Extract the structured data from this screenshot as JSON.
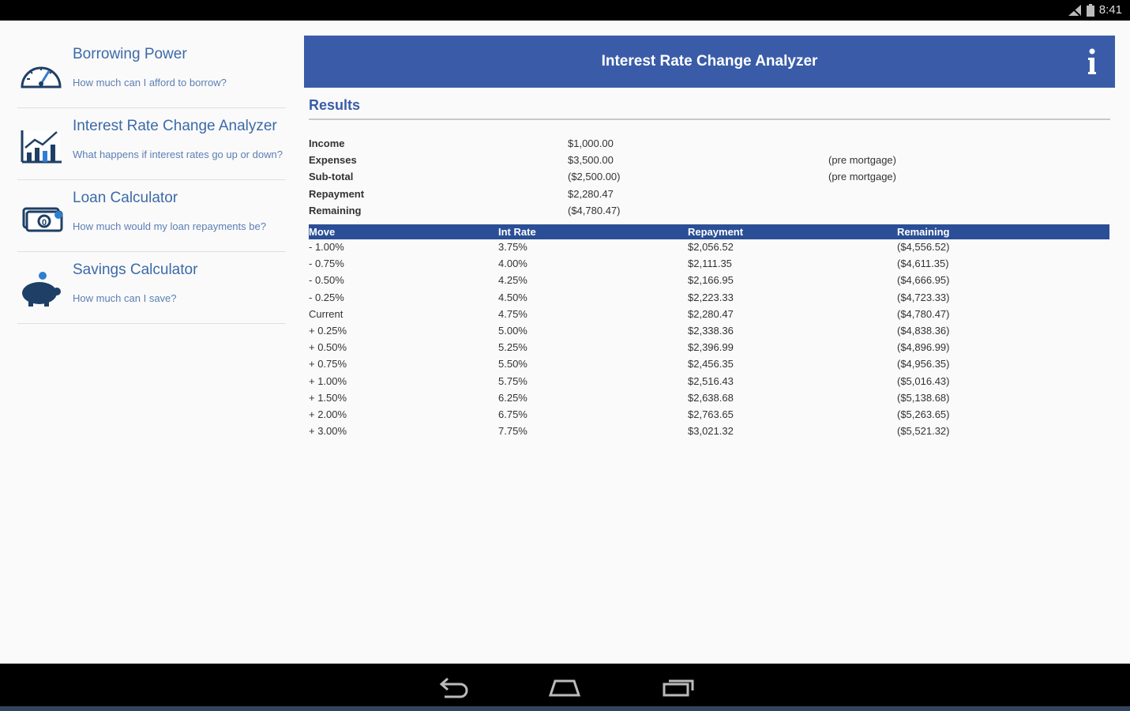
{
  "status_bar": {
    "time": "8:41"
  },
  "sidebar": {
    "items": [
      {
        "title": "Borrowing Power",
        "subtitle": "How much can I afford to borrow?",
        "icon": "speedometer-icon"
      },
      {
        "title": "Interest Rate Change Analyzer",
        "subtitle": "What happens if interest rates go up or down?",
        "icon": "bar-chart-icon"
      },
      {
        "title": "Loan Calculator",
        "subtitle": "How much would my loan repayments be?",
        "icon": "money-icon"
      },
      {
        "title": "Savings Calculator",
        "subtitle": "How much can I save?",
        "icon": "piggy-bank-icon"
      }
    ]
  },
  "header": {
    "title": "Interest Rate Change Analyzer",
    "info_label": "i"
  },
  "results": {
    "title": "Results",
    "summary": [
      {
        "label": "Income",
        "value": "$1,000.00",
        "note": ""
      },
      {
        "label": "Expenses",
        "value": "$3,500.00",
        "note": "(pre mortgage)"
      },
      {
        "label": "Sub-total",
        "value": "($2,500.00)",
        "note": "(pre mortgage)"
      },
      {
        "label": "Repayment",
        "value": "$2,280.47",
        "note": ""
      },
      {
        "label": "Remaining",
        "value": "($4,780.47)",
        "note": ""
      }
    ],
    "table": {
      "headers": [
        "Move",
        "Int Rate",
        "Repayment",
        "Remaining"
      ],
      "rows": [
        [
          "- 1.00%",
          "3.75%",
          "$2,056.52",
          "($4,556.52)"
        ],
        [
          "- 0.75%",
          "4.00%",
          "$2,111.35",
          "($4,611.35)"
        ],
        [
          "- 0.50%",
          "4.25%",
          "$2,166.95",
          "($4,666.95)"
        ],
        [
          "- 0.25%",
          "4.50%",
          "$2,223.33",
          "($4,723.33)"
        ],
        [
          "Current",
          "4.75%",
          "$2,280.47",
          "($4,780.47)"
        ],
        [
          "+ 0.25%",
          "5.00%",
          "$2,338.36",
          "($4,838.36)"
        ],
        [
          "+ 0.50%",
          "5.25%",
          "$2,396.99",
          "($4,896.99)"
        ],
        [
          "+ 0.75%",
          "5.50%",
          "$2,456.35",
          "($4,956.35)"
        ],
        [
          "+ 1.00%",
          "5.75%",
          "$2,516.43",
          "($5,016.43)"
        ],
        [
          "+ 1.50%",
          "6.25%",
          "$2,638.68",
          "($5,138.68)"
        ],
        [
          "+ 2.00%",
          "6.75%",
          "$2,763.65",
          "($5,263.65)"
        ],
        [
          "+ 3.00%",
          "7.75%",
          "$3,021.32",
          "($5,521.32)"
        ]
      ]
    }
  },
  "nav": {
    "buttons": [
      "back-icon",
      "home-icon",
      "recents-icon"
    ]
  },
  "colors": {
    "header": "#3a5ca8",
    "table_header": "#2b4f96",
    "link": "#3c6aa8"
  }
}
